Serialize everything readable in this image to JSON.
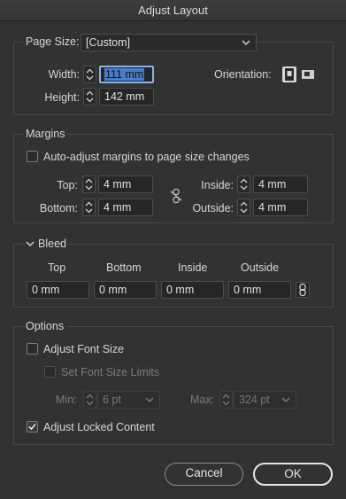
{
  "window": {
    "title": "Adjust Layout"
  },
  "page": {
    "page_size_label": "Page Size:",
    "page_size_value": "[Custom]",
    "width_label": "Width:",
    "width_value": "111 mm",
    "height_label": "Height:",
    "height_value": "142 mm",
    "orientation_label": "Orientation:"
  },
  "margins": {
    "title": "Margins",
    "auto_adjust_label": "Auto-adjust margins to page size changes",
    "auto_adjust_checked": false,
    "top_label": "Top:",
    "top_value": "4 mm",
    "bottom_label": "Bottom:",
    "bottom_value": "4 mm",
    "inside_label": "Inside:",
    "inside_value": "4 mm",
    "outside_label": "Outside:",
    "outside_value": "4 mm"
  },
  "bleed": {
    "title": "Bleed",
    "columns": [
      "Top",
      "Bottom",
      "Inside",
      "Outside"
    ],
    "values": [
      "0 mm",
      "0 mm",
      "0 mm",
      "0 mm"
    ]
  },
  "options": {
    "title": "Options",
    "adjust_font_size_label": "Adjust Font Size",
    "adjust_font_size_checked": false,
    "set_font_size_limits_label": "Set Font Size Limits",
    "set_font_size_limits_checked": false,
    "min_label": "Min:",
    "min_value": "6 pt",
    "max_label": "Max:",
    "max_value": "324 pt",
    "adjust_locked_label": "Adjust Locked Content",
    "adjust_locked_checked": true
  },
  "buttons": {
    "cancel": "Cancel",
    "ok": "OK"
  },
  "colors": {
    "background": "#323232",
    "field": "#262626",
    "selection": "#4a7ec8",
    "focus_ring": "#8fb1e3"
  }
}
